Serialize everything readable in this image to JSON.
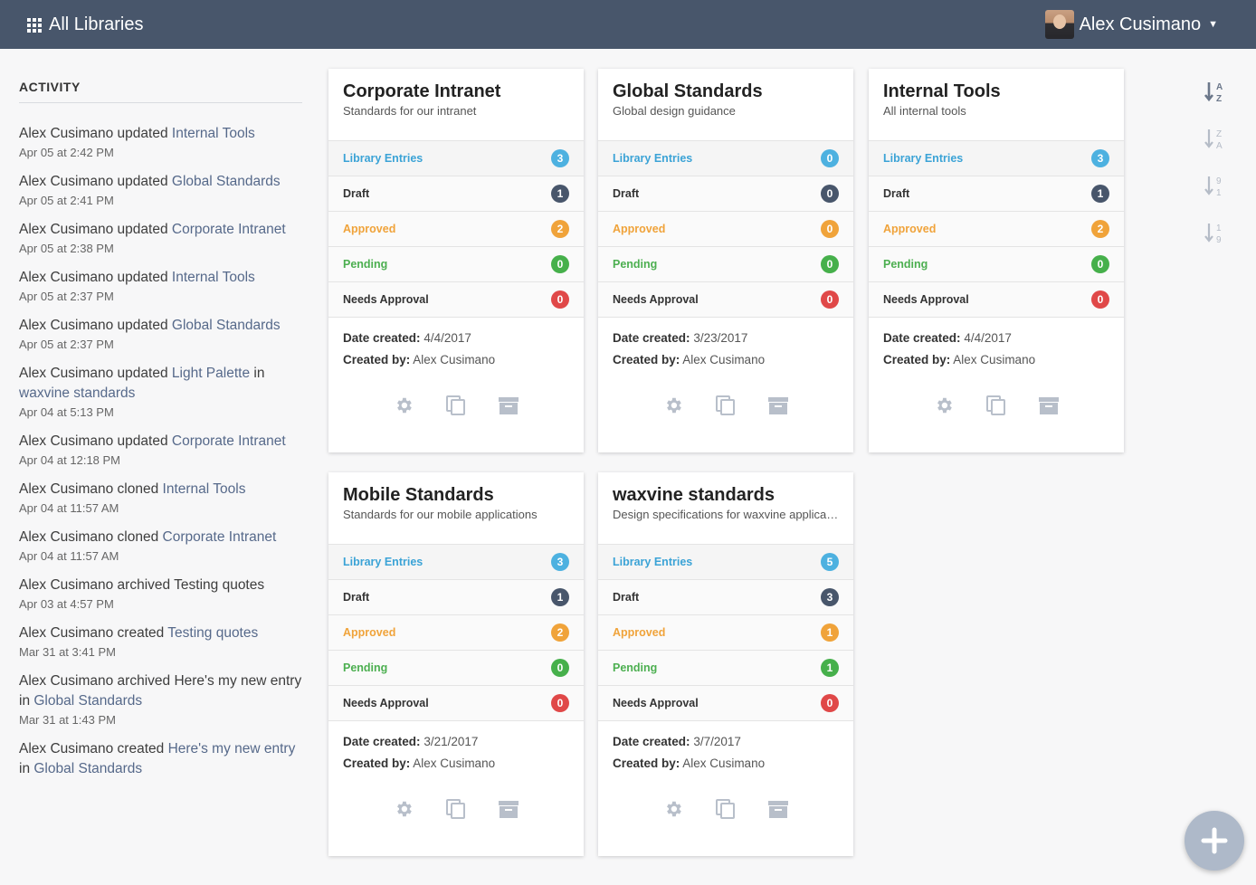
{
  "header": {
    "title": "All Libraries",
    "user_name": "Alex Cusimano"
  },
  "sidebar": {
    "title": "ACTIVITY",
    "items": [
      {
        "pre": "Alex Cusimano updated ",
        "link": "Internal Tools",
        "post": "",
        "time": "Apr 05 at 2:42 PM"
      },
      {
        "pre": "Alex Cusimano updated ",
        "link": "Global Standards",
        "post": "",
        "time": "Apr 05 at 2:41 PM"
      },
      {
        "pre": "Alex Cusimano updated ",
        "link": "Corporate Intranet",
        "post": "",
        "time": "Apr 05 at 2:38 PM"
      },
      {
        "pre": "Alex Cusimano updated ",
        "link": "Internal Tools",
        "post": "",
        "time": "Apr 05 at 2:37 PM"
      },
      {
        "pre": "Alex Cusimano updated ",
        "link": "Global Standards",
        "post": "",
        "time": "Apr 05 at 2:37 PM"
      },
      {
        "pre": "Alex Cusimano updated ",
        "link": "Light Palette",
        "post": " in ",
        "link2": "waxvine standards",
        "time": "Apr 04 at 5:13 PM"
      },
      {
        "pre": "Alex Cusimano updated ",
        "link": "Corporate Intranet",
        "post": "",
        "time": "Apr 04 at 12:18 PM"
      },
      {
        "pre": "Alex Cusimano cloned ",
        "link": "Internal Tools",
        "post": "",
        "time": "Apr 04 at 11:57 AM"
      },
      {
        "pre": "Alex Cusimano cloned ",
        "link": "Corporate Intranet",
        "post": "",
        "time": "Apr 04 at 11:57 AM"
      },
      {
        "pre": "Alex Cusimano archived Testing quotes",
        "link": "",
        "post": "",
        "time": "Apr 03 at 4:57 PM"
      },
      {
        "pre": "Alex Cusimano created ",
        "link": "Testing quotes",
        "post": "",
        "time": "Mar 31 at 3:41 PM"
      },
      {
        "pre": "Alex Cusimano archived Here's my new entry in ",
        "link": "Global Standards",
        "post": "",
        "time": "Mar 31 at 1:43 PM"
      },
      {
        "pre": "Alex Cusimano created ",
        "link": "Here's my new entry",
        "post": " in ",
        "link2": "Global Standards",
        "time": ""
      }
    ]
  },
  "labels": {
    "library_entries": "Library Entries",
    "draft": "Draft",
    "approved": "Approved",
    "pending": "Pending",
    "needs_approval": "Needs Approval",
    "date_created": "Date created:",
    "created_by": "Created by:"
  },
  "libraries": [
    {
      "title": "Corporate Intranet",
      "description": "Standards for our intranet",
      "entries": "3",
      "draft": "1",
      "approved": "2",
      "pending": "0",
      "needs_approval": "0",
      "date": "4/4/2017",
      "creator": "Alex Cusimano"
    },
    {
      "title": "Global Standards",
      "description": "Global design guidance",
      "entries": "0",
      "draft": "0",
      "approved": "0",
      "pending": "0",
      "needs_approval": "0",
      "date": "3/23/2017",
      "creator": "Alex Cusimano"
    },
    {
      "title": "Internal Tools",
      "description": "All internal tools",
      "entries": "3",
      "draft": "1",
      "approved": "2",
      "pending": "0",
      "needs_approval": "0",
      "date": "4/4/2017",
      "creator": "Alex Cusimano"
    },
    {
      "title": "Mobile Standards",
      "description": "Standards for our mobile applications",
      "entries": "3",
      "draft": "1",
      "approved": "2",
      "pending": "0",
      "needs_approval": "0",
      "date": "3/21/2017",
      "creator": "Alex Cusimano"
    },
    {
      "title": "waxvine standards",
      "description": "Design specifications for waxvine applicat...",
      "entries": "5",
      "draft": "3",
      "approved": "1",
      "pending": "1",
      "needs_approval": "0",
      "date": "3/7/2017",
      "creator": "Alex Cusimano"
    }
  ],
  "sort": {
    "a_z": "A-Z",
    "z_a": "Z-A",
    "9_1": "9-1",
    "1_9": "1-9"
  },
  "colors": {
    "header_bg": "#48566b",
    "link": "#56698a",
    "blue": "#4db1e0",
    "orange": "#f0a33a",
    "green": "#46b04b",
    "red": "#e04848",
    "fab": "#aeb9c9"
  }
}
